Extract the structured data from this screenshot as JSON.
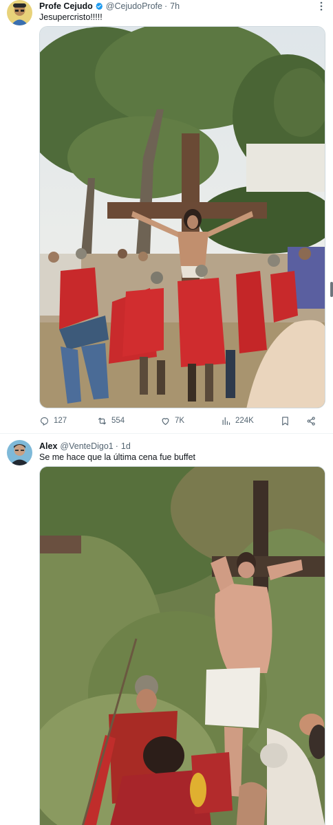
{
  "tweets": [
    {
      "author": "Profe Cejudo",
      "verified": true,
      "handle": "@CejudoProfe",
      "separator": "·",
      "time": "7h",
      "text": "Jesupercristo!!!!!",
      "media_icon": "photo",
      "stats": {
        "replies": "127",
        "retweets": "554",
        "likes": "7K",
        "views": "224K"
      }
    },
    {
      "author": "Alex",
      "verified": false,
      "handle": "@VenteDigo1",
      "separator": "·",
      "time": "1d",
      "text": "Se me hace que la última cena fue buffet",
      "media_icon": "photo"
    }
  ],
  "colors": {
    "text_primary": "#0f1419",
    "text_secondary": "#536471",
    "verified_blue": "#1d9bf0",
    "divider": "#eff3f4"
  }
}
